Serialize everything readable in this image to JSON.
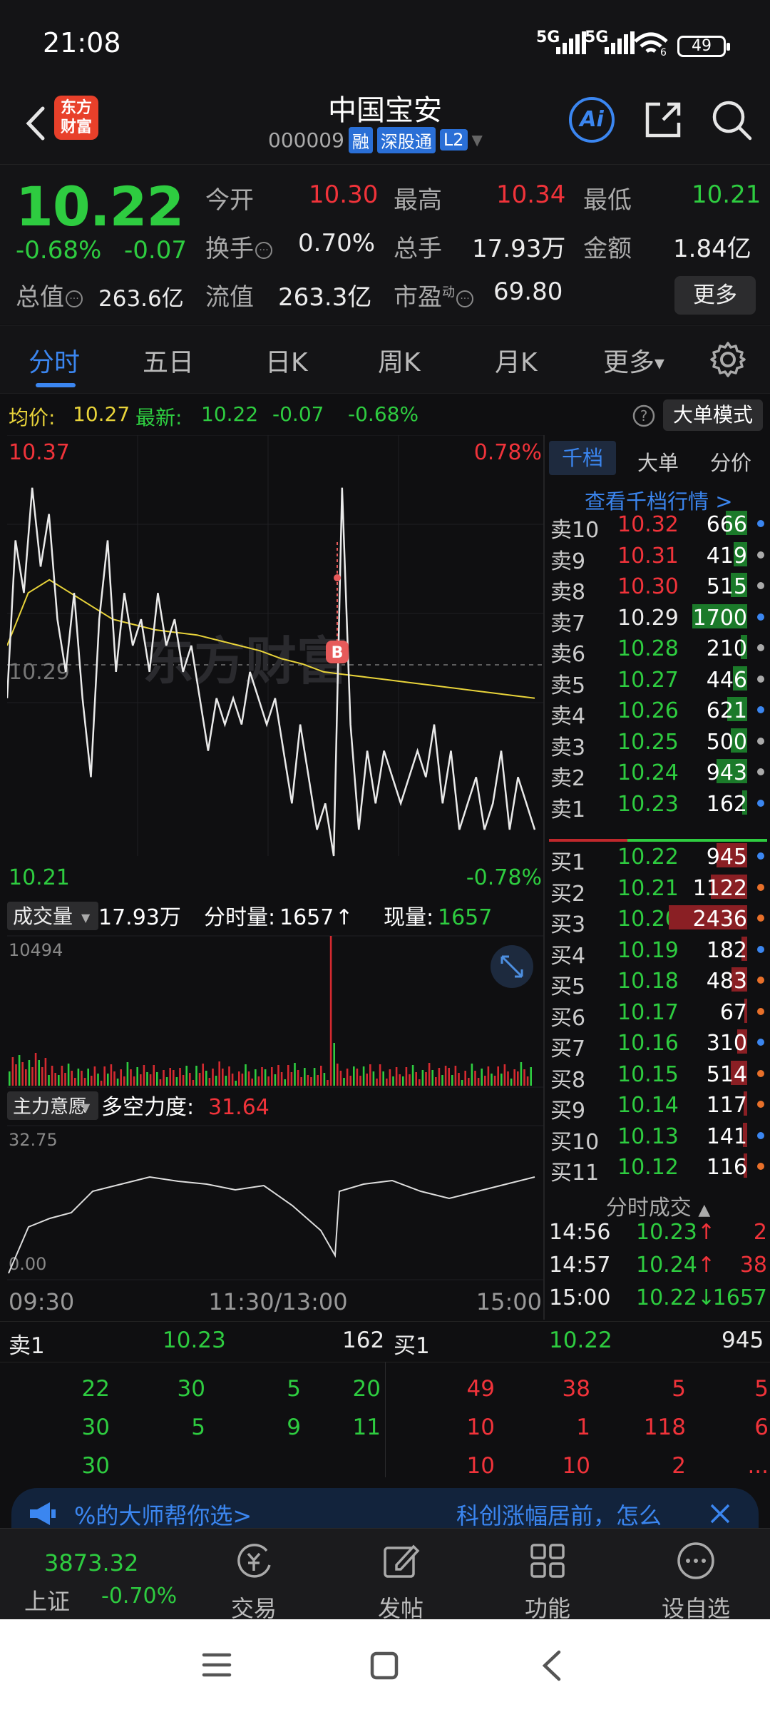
{
  "status": {
    "time": "21:08",
    "sig1": "5G",
    "sig2": "5G",
    "wifi_sub": "6",
    "battery": "49"
  },
  "header": {
    "logo_line1": "东方",
    "logo_line2": "财富",
    "name": "中国宝安",
    "code": "000009",
    "tags": [
      "融",
      "深股通",
      "L2"
    ],
    "ai_label": "Ai"
  },
  "quote": {
    "price": "10.22",
    "pct": "-0.68%",
    "chg": "-0.07",
    "open_label": "今开",
    "open": "10.30",
    "high_label": "最高",
    "high": "10.34",
    "low_label": "最低",
    "low": "10.21",
    "turnover_label": "换手",
    "turnover": "0.70%",
    "volume_label": "总手",
    "volume": "17.93万",
    "amount_label": "金额",
    "amount": "1.84亿",
    "mcap_label": "总值",
    "mcap": "263.6亿",
    "float_label": "流值",
    "float": "263.3亿",
    "pe_label": "市盈",
    "pe_sup": "动",
    "pe": "69.80",
    "more": "更多"
  },
  "tabs": [
    "分时",
    "五日",
    "日K",
    "周K",
    "月K",
    "更多"
  ],
  "avg": {
    "avg_label": "均价:",
    "avg": "10.27",
    "last_label": "最新:",
    "last": "10.22",
    "chg": "-0.07",
    "pct": "-0.68%",
    "big_mode": "大单模式"
  },
  "chart": {
    "ymax": "10.37",
    "ymin": "10.21",
    "pmax": "0.78%",
    "pmin": "-0.78%",
    "mid": "10.29",
    "watermark": "东方财富",
    "marker": "B",
    "vol_label": "成交量",
    "vol_total": "17.93万",
    "vol_min_label": "分时量:",
    "vol_min": "1657",
    "vol_now_label": "现量:",
    "vol_now": "1657",
    "vol_max": "10494",
    "ind_label": "主力意愿",
    "ind_name": "多空力度:",
    "ind_val": "31.64",
    "ind_max": "32.75",
    "ind_min": "0.00",
    "time_start": "09:30",
    "time_mid": "11:30/13:00",
    "time_end": "15:00"
  },
  "chart_data": {
    "type": "line",
    "x_labels": [
      "09:30",
      "11:30/13:00",
      "15:00"
    ],
    "ylim": [
      10.21,
      10.37
    ],
    "reference": 10.29,
    "price_series": [
      10.27,
      10.33,
      10.31,
      10.35,
      10.32,
      10.34,
      10.3,
      10.28,
      10.31,
      10.27,
      10.24,
      10.3,
      10.33,
      10.28,
      10.31,
      10.29,
      10.3,
      10.28,
      10.31,
      10.29,
      10.3,
      10.28,
      10.29,
      10.27,
      10.25,
      10.27,
      10.26,
      10.27,
      10.26,
      10.28,
      10.27,
      10.26,
      10.27,
      10.25,
      10.23,
      10.26,
      10.24,
      10.22,
      10.23,
      10.21,
      10.35,
      10.26,
      10.22,
      10.25,
      10.23,
      10.25,
      10.24,
      10.23,
      10.24,
      10.25,
      10.24,
      10.26,
      10.23,
      10.25,
      10.22,
      10.23,
      10.24,
      10.22,
      10.23,
      10.25,
      10.22,
      10.24,
      10.23,
      10.22
    ],
    "avg_series": [
      10.29,
      10.31,
      10.315,
      10.31,
      10.305,
      10.3,
      10.298,
      10.296,
      10.295,
      10.294,
      10.292,
      10.29,
      10.288,
      10.285,
      10.283,
      10.28,
      10.279,
      10.278,
      10.277,
      10.276,
      10.275,
      10.274,
      10.273,
      10.272,
      10.271,
      10.27
    ]
  },
  "orderbook": {
    "tabs": [
      "千档",
      "大单",
      "分价"
    ],
    "link": "查看千档行情 >",
    "asks": [
      {
        "label": "卖10",
        "price": "10.32",
        "vol": "666",
        "color": "red"
      },
      {
        "label": "卖9",
        "price": "10.31",
        "vol": "419",
        "color": "red"
      },
      {
        "label": "卖8",
        "price": "10.30",
        "vol": "515",
        "color": "red"
      },
      {
        "label": "卖7",
        "price": "10.29",
        "vol": "1700",
        "color": "white"
      },
      {
        "label": "卖6",
        "price": "10.28",
        "vol": "210",
        "color": "green"
      },
      {
        "label": "卖5",
        "price": "10.27",
        "vol": "446",
        "color": "green"
      },
      {
        "label": "卖4",
        "price": "10.26",
        "vol": "621",
        "color": "green"
      },
      {
        "label": "卖3",
        "price": "10.25",
        "vol": "500",
        "color": "green"
      },
      {
        "label": "卖2",
        "price": "10.24",
        "vol": "943",
        "color": "green"
      },
      {
        "label": "卖1",
        "price": "10.23",
        "vol": "162",
        "color": "green"
      }
    ],
    "bids": [
      {
        "label": "买1",
        "price": "10.22",
        "vol": "945",
        "color": "green"
      },
      {
        "label": "买2",
        "price": "10.21",
        "vol": "1122",
        "color": "green"
      },
      {
        "label": "买3",
        "price": "10.20",
        "vol": "2436",
        "color": "green"
      },
      {
        "label": "买4",
        "price": "10.19",
        "vol": "182",
        "color": "green"
      },
      {
        "label": "买5",
        "price": "10.18",
        "vol": "483",
        "color": "green"
      },
      {
        "label": "买6",
        "price": "10.17",
        "vol": "67",
        "color": "green"
      },
      {
        "label": "买7",
        "price": "10.16",
        "vol": "310",
        "color": "green"
      },
      {
        "label": "买8",
        "price": "10.15",
        "vol": "514",
        "color": "green"
      },
      {
        "label": "买9",
        "price": "10.14",
        "vol": "117",
        "color": "green"
      },
      {
        "label": "买10",
        "price": "10.13",
        "vol": "141",
        "color": "green"
      },
      {
        "label": "买11",
        "price": "10.12",
        "vol": "116",
        "color": "green"
      }
    ],
    "trades_title": "分时成交",
    "trades": [
      {
        "time": "14:56",
        "price": "10.23",
        "arrow": "↑",
        "vol": "2"
      },
      {
        "time": "14:57",
        "price": "10.24",
        "arrow": "↑",
        "vol": "38"
      },
      {
        "time": "15:00",
        "price": "10.22",
        "arrow": "↓",
        "vol": "1657"
      }
    ]
  },
  "queue": {
    "sell_label": "卖1",
    "sell_price": "10.23",
    "sell_vol": "162",
    "buy_label": "买1",
    "buy_price": "10.22",
    "buy_vol": "945",
    "sell_cells": [
      [
        "22",
        "30",
        "5",
        "20"
      ],
      [
        "30",
        "5",
        "9",
        "11"
      ],
      [
        "30",
        "",
        "",
        ""
      ]
    ],
    "buy_cells": [
      [
        "49",
        "38",
        "5",
        "5"
      ],
      [
        "10",
        "1",
        "118",
        "6"
      ],
      [
        "10",
        "10",
        "2",
        "..."
      ]
    ]
  },
  "banner": {
    "left": "%的大师帮你选>",
    "right": "科创涨幅居前，怎么"
  },
  "bottom_nav": {
    "index_value": "3873.32",
    "index_name": "上证",
    "index_pct": "-0.70%",
    "items": [
      "交易",
      "发帖",
      "功能",
      "设自选"
    ]
  }
}
